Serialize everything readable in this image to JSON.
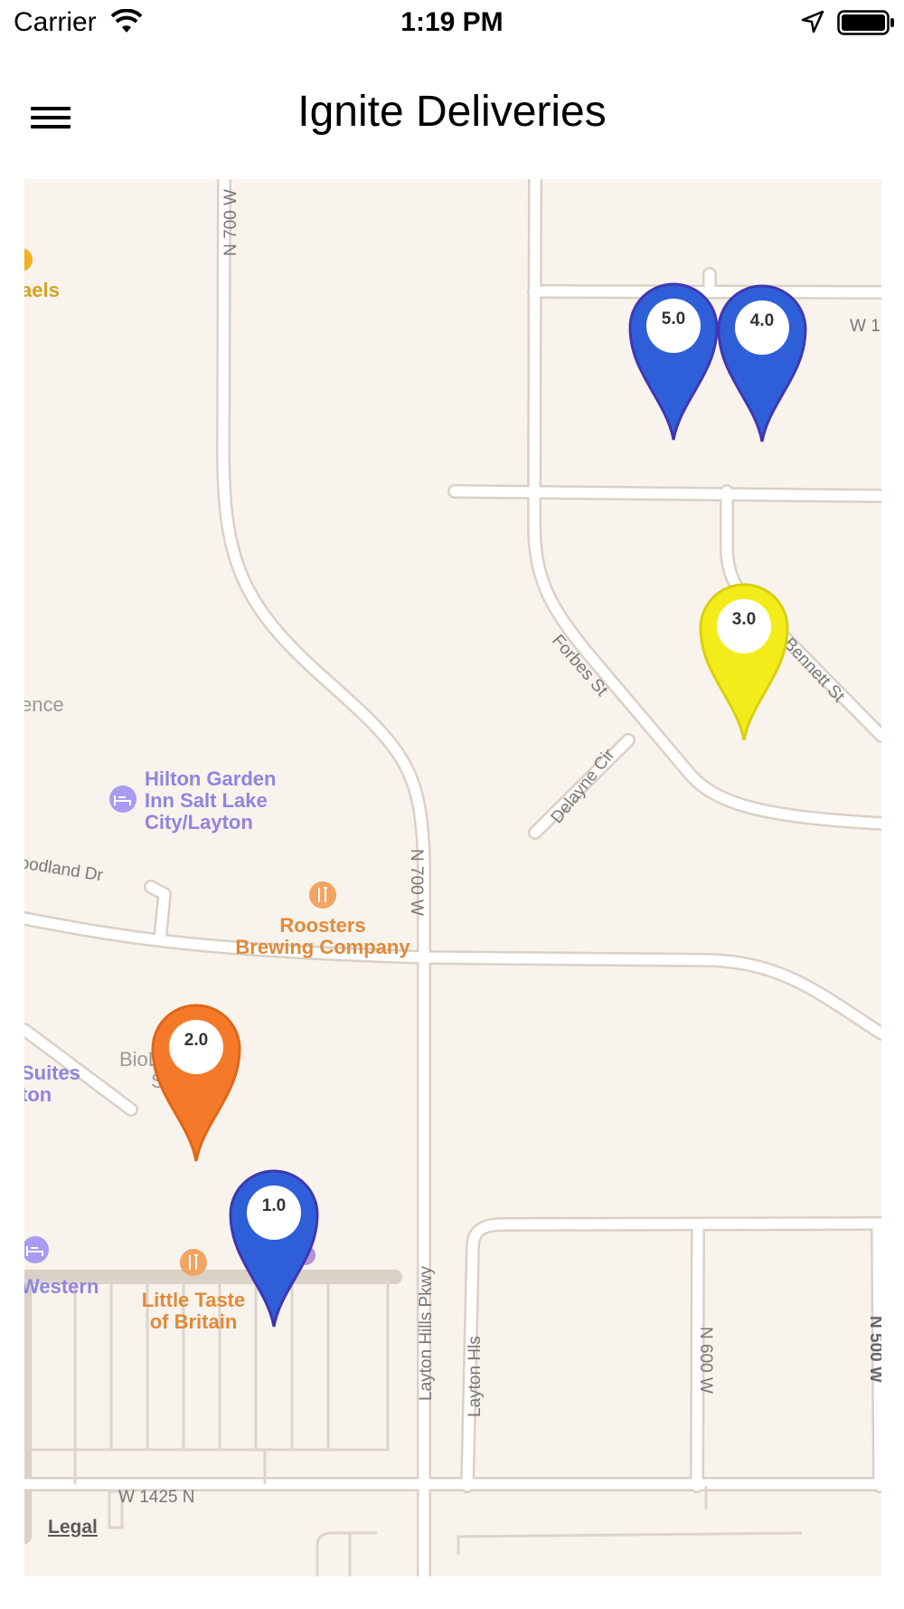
{
  "status_bar": {
    "carrier": "Carrier",
    "time": "1:19 PM"
  },
  "nav": {
    "title": "Ignite Deliveries"
  },
  "map": {
    "legal": "Legal",
    "streets": {
      "n700w_top": "N 700 W",
      "w1_partial": "W 1",
      "forbes": "Forbes St",
      "bennett": "Bennett St",
      "delayne": "Delayne Cir",
      "woodland": "oodland Dr",
      "n700w_mid": "N 700 W",
      "layton_hills_pkwy": "Layton Hills Pkwy",
      "layton_hls": "Layton Hls",
      "n600w": "N 600 W",
      "w1425n": "W 1425 N",
      "n500w_partial": "N 500 W"
    },
    "pois": {
      "michaels_partial": "aels",
      "ence_partial": "ence",
      "hilton_l1": "Hilton Garden",
      "hilton_l2": "Inn Salt Lake",
      "hilton_l3": "City/Layton",
      "roosters_l1": "Roosters",
      "roosters_l2": "Brewing Company",
      "biolife_l1": "BioL  sma",
      "biolife_l2": "Se  es",
      "suites_l1": "Suites",
      "suites_l2": "ton",
      "western": "Western",
      "little_taste_l1": "Little Taste",
      "little_taste_l2": "of Britain"
    },
    "colors": {
      "blue_pin": "#2f5fd8",
      "orange_pin": "#f47a2a",
      "yellow_pin": "#f4ec1a"
    },
    "markers": [
      {
        "label": "5.0",
        "color": "blue"
      },
      {
        "label": "4.0",
        "color": "blue"
      },
      {
        "label": "3.0",
        "color": "yellow"
      },
      {
        "label": "2.0",
        "color": "orange"
      },
      {
        "label": "1.0",
        "color": "blue"
      }
    ]
  }
}
